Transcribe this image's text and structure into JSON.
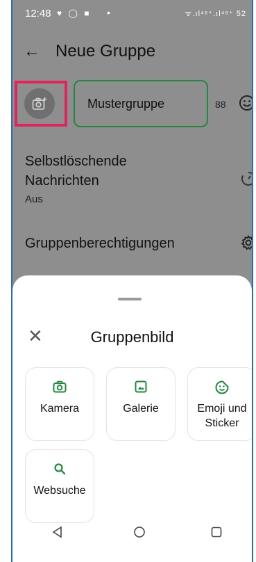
{
  "status_bar": {
    "time": "12:48",
    "left_icons": "♥ ◯ ■",
    "dot": "•",
    "right_icons": "ᯤ.ıl⁴⁶⁺.ıl⁴⁶⁺ 52"
  },
  "header": {
    "back_icon": "arrow-left-icon",
    "title": "Neue Gruppe"
  },
  "group": {
    "avatar_icon": "camera-add-icon",
    "name_value": "Mustergruppe",
    "char_count": "88",
    "emoji_icon": "smiley-icon"
  },
  "settings": [
    {
      "title": "Selbstlöschende Nachrichten",
      "subtitle": "Aus",
      "icon": "timer-icon"
    },
    {
      "title": "Gruppenberechtigungen",
      "icon": "gear-icon"
    }
  ],
  "bottom_sheet": {
    "title": "Gruppenbild",
    "close_icon": "close-icon",
    "options": [
      {
        "label": "Kamera",
        "icon": "camera-icon"
      },
      {
        "label": "Galerie",
        "icon": "gallery-icon"
      },
      {
        "label": "Emoji und Sticker",
        "icon": "sticker-icon"
      },
      {
        "label": "Websuche",
        "icon": "search-icon"
      }
    ]
  },
  "navbar": {
    "back_icon": "nav-back-icon",
    "home_icon": "nav-home-icon",
    "recents_icon": "nav-recents-icon"
  },
  "colors": {
    "accent_green": "#1f8a3c",
    "highlight_pink": "#e0245e",
    "dim_overlay": "#8e8e8e"
  }
}
